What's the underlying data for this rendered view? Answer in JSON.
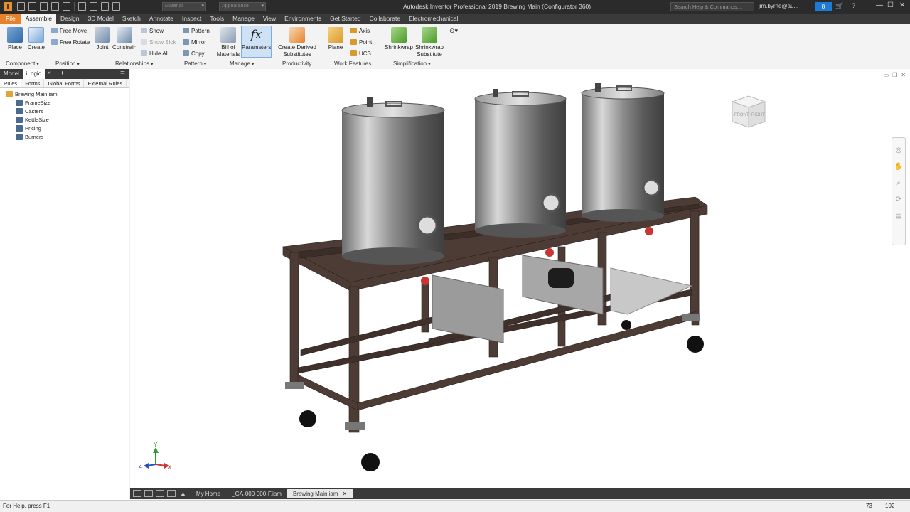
{
  "app": {
    "logo_letter": "I",
    "title": "Autodesk Inventor Professional 2019   Brewing Main (Configurator 360)",
    "material_placeholder": "Material",
    "appearance_placeholder": "Appearance",
    "search_placeholder": "Search Help & Commands...",
    "user": "jim.byrne@au...",
    "notification_count": "8"
  },
  "tabs": [
    "File",
    "Assemble",
    "Design",
    "3D Model",
    "Sketch",
    "Annotate",
    "Inspect",
    "Tools",
    "Manage",
    "View",
    "Environments",
    "Get Started",
    "Collaborate",
    "Electromechanical"
  ],
  "ribbon": {
    "place": "Place",
    "create": "Create",
    "free_move": "Free Move",
    "free_rotate": "Free Rotate",
    "joint": "Joint",
    "constrain": "Constrain",
    "show": "Show",
    "show_sick": "Show Sick",
    "hide_all": "Hide All",
    "pattern": "Pattern",
    "mirror": "Mirror",
    "copy": "Copy",
    "bom_line1": "Bill of",
    "bom_line2": "Materials",
    "parameters": "Parameters",
    "derived_line1": "Create Derived",
    "derived_line2": "Substitutes",
    "plane": "Plane",
    "axis": "Axis",
    "point": "Point",
    "ucs": "UCS",
    "shrinkwrap": "Shrinkwrap",
    "sw_sub_line1": "Shrinkwrap",
    "sw_sub_line2": "Substitute",
    "panels": {
      "component": "Component",
      "position": "Position",
      "relationships": "Relationships",
      "pattern": "Pattern",
      "manage": "Manage",
      "productivity": "Productivity",
      "work_features": "Work Features",
      "simplification": "Simplification"
    }
  },
  "browser": {
    "tab_model": "Model",
    "tab_ilogic": "iLogic",
    "subtabs": [
      "Rules",
      "Forms",
      "Global Forms",
      "External Rules"
    ],
    "root": "Brewing Main.iam",
    "rules": [
      "FrameSize",
      "Casters",
      "KettleSize",
      "Pricing",
      "Burners"
    ]
  },
  "viewcube": {
    "front": "FRONT",
    "right": "RIGHT"
  },
  "triad": {
    "x": "X",
    "y": "Y",
    "z": "Z"
  },
  "doc_tabs": [
    "My Home",
    "_GA-000-000-F.iam",
    "Brewing Main.iam"
  ],
  "status": {
    "help": "For Help, press F1",
    "n1": "73",
    "n2": "102"
  },
  "colors": {
    "accent_orange": "#e7822c",
    "frame_brown": "#4a3a33",
    "dark_chrome": "#2b2b2b"
  }
}
